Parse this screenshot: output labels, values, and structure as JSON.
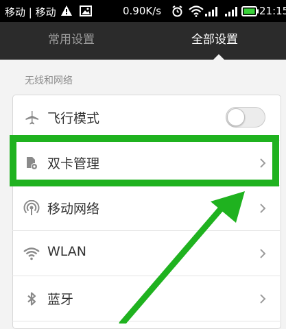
{
  "status_bar": {
    "carrier": "移动 | 移动",
    "net_speed": "0.90K/s",
    "time": "21:15"
  },
  "tabs": [
    {
      "label": "常用设置",
      "active": false
    },
    {
      "label": "全部设置",
      "active": true
    }
  ],
  "section": {
    "title": "无线和网络",
    "items": [
      {
        "label": "飞行模式",
        "icon": "airplane-icon",
        "control": "toggle",
        "toggle_on": false
      },
      {
        "label": "双卡管理",
        "icon": "dual-sim-icon",
        "control": "chevron"
      },
      {
        "label": "移动网络",
        "icon": "mobile-network-icon",
        "control": "chevron"
      },
      {
        "label": "WLAN",
        "icon": "wifi-icon",
        "control": "chevron"
      },
      {
        "label": "蓝牙",
        "icon": "bluetooth-icon",
        "control": "chevron"
      }
    ]
  },
  "annotation": {
    "highlight_color": "#1fb21f",
    "highlighted_item": "双卡管理"
  }
}
